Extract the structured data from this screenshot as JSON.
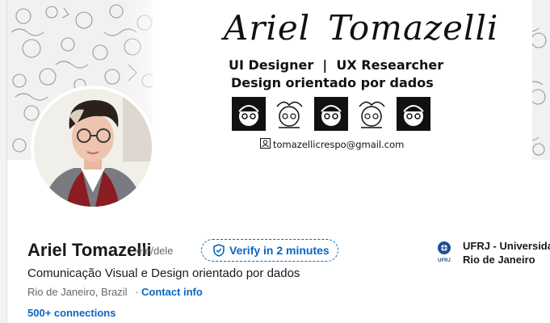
{
  "banner": {
    "signature_first": "Ariel",
    "signature_last": "Tomazelli",
    "role": "UI Designer  |  UX Researcher",
    "tagline": "Design orientado por dados",
    "email": "tomazellicrespo@gmail.com"
  },
  "profile": {
    "name": "Ariel Tomazelli",
    "pronouns": "ele/dele",
    "verify_label": "Verify in 2 minutes",
    "headline": "Comunicação Visual e Design orientado por dados",
    "location": "Rio de Janeiro, Brazil",
    "separator": "·",
    "contact_label": "Contact info",
    "connections": "500+ connections"
  },
  "education": {
    "line1": "UFRJ - Universida",
    "line2": "Rio de Janeiro",
    "logo_text": "UFRJ"
  },
  "colors": {
    "link": "#0a66c2",
    "text": "#191919",
    "muted": "#666666"
  }
}
